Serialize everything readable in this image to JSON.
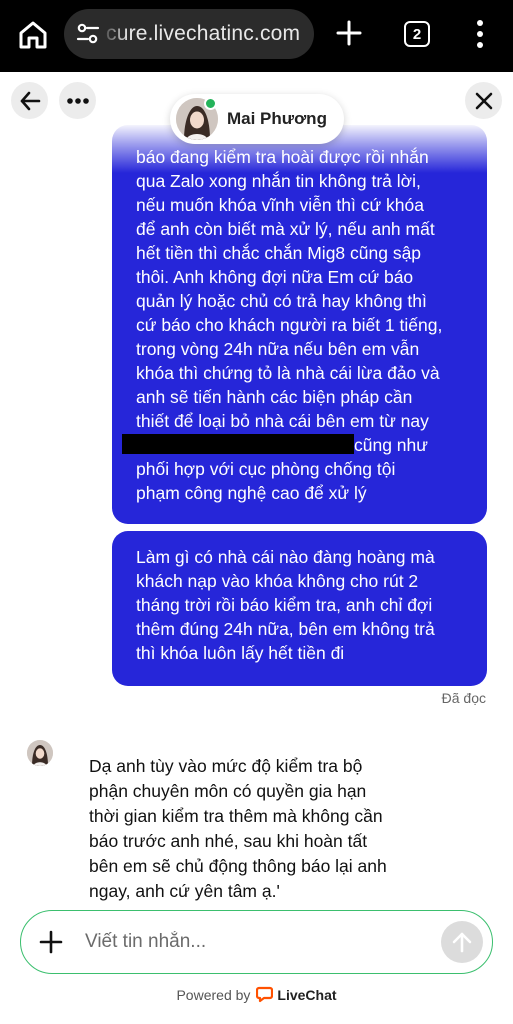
{
  "browser": {
    "url": "cure.livechatinc.com",
    "tab_count": "2",
    "icons": [
      "home-icon",
      "site-settings-icon",
      "plus-icon",
      "tab-switcher-icon",
      "more-vert-icon"
    ]
  },
  "chat_header": {
    "agent_name": "Mai Phương",
    "agent_status": "online",
    "icons": [
      "back-arrow-icon",
      "more-horizontal-icon",
      "close-icon"
    ]
  },
  "messages": {
    "visitor_1": {
      "lines": [
        "báo đang kiểm tra hoài được rồi nhắn",
        "qua Zalo xong nhắn tin không trả lời,",
        "nếu muốn khóa vĩnh viễn thì cứ khóa",
        "để anh còn biết mà xử lý, nếu anh mất",
        "hết tiền thì chắc chắn Mig8 cũng sập",
        "thôi. Anh không đợi nữa Em cứ báo",
        "quản lý hoặc chủ có trả hay không thì",
        "cứ báo cho khách người ra biết 1 tiếng,",
        "trong vòng 24h nữa nếu bên em vẫn",
        "khóa thì chứng tỏ là nhà cái lừa đảo và",
        "anh sẽ tiến hành các biện pháp cần",
        "thiết để loại bỏ nhà cái bên em từ nay"
      ],
      "after_redaction": "cũng như",
      "tail_lines": [
        "phối hợp với cục phòng chống tội",
        "phạm công nghệ cao để xử lý"
      ]
    },
    "visitor_2": {
      "lines": [
        "Làm gì có nhà cái nào đàng hoàng mà",
        "khách nạp vào khóa không cho rút 2",
        "tháng trời rồi báo kiểm tra, anh chỉ đợi",
        "thêm đúng 24h nữa, bên em không trả",
        "thì khóa luôn lấy hết tiền đi"
      ],
      "status": "Đã đọc"
    },
    "agent_1": {
      "lines": [
        "Dạ anh tùy vào mức độ kiểm tra bộ",
        "phận chuyên môn có quyền gia hạn",
        "thời gian kiểm tra thêm mà không cần",
        "báo trước anh nhé, sau khi hoàn tất",
        "bên em sẽ chủ động thông báo lại anh",
        "ngay, anh cứ yên tâm ạ.'"
      ]
    }
  },
  "composer": {
    "placeholder": "Viết tin nhắn...",
    "value": "",
    "icons": [
      "plus-icon",
      "send-arrow-up-icon"
    ]
  },
  "footer": {
    "powered_by": "Powered by",
    "brand": "LiveChat",
    "brand_color": "#ff5100"
  },
  "colors": {
    "visitor_bubble": "#2626d9",
    "composer_border": "#3bbf6e",
    "online_dot": "#24b35a"
  }
}
